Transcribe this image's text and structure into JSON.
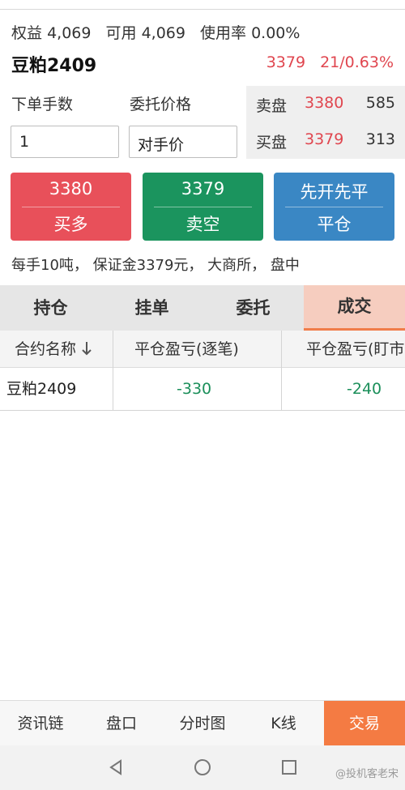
{
  "account": {
    "equity_label": "权益",
    "equity_value": "4,069",
    "available_label": "可用",
    "available_value": "4,069",
    "usage_label": "使用率",
    "usage_value": "0.00%"
  },
  "symbol": {
    "name": "豆粕2409",
    "price": "3379",
    "change": "21/0.63%"
  },
  "order_form": {
    "qty_label": "下单手数",
    "qty_value": "1",
    "price_label": "委托价格",
    "price_value": "对手价"
  },
  "order_book": [
    {
      "label": "卖盘",
      "price": "3380",
      "volume": "585"
    },
    {
      "label": "买盘",
      "price": "3379",
      "volume": "313"
    }
  ],
  "actions": {
    "buy": {
      "price": "3380",
      "label": "买多"
    },
    "sell": {
      "price": "3379",
      "label": "卖空"
    },
    "close": {
      "price": "先开先平",
      "label": "平仓"
    }
  },
  "contract_info": "每手10吨， 保证金3379元， 大商所， 盘中",
  "tabs": [
    "持仓",
    "挂单",
    "委托",
    "成交"
  ],
  "active_tab": "成交",
  "table": {
    "headers": [
      "合约名称",
      "平仓盈亏(逐笔)",
      "平仓盈亏(盯市)"
    ],
    "sort_icon": "arrow-down-icon",
    "rows": [
      {
        "contract": "豆粕2409",
        "pnl_trade": "-330",
        "pnl_mark": "-240"
      }
    ]
  },
  "bottom_nav": [
    "资讯链",
    "盘口",
    "分时图",
    "K线",
    "交易"
  ],
  "watermark": "@投机客老宋",
  "colors": {
    "red": "#e0464f",
    "green": "#1b8f5a",
    "blue": "#3a87c4",
    "orange": "#f47b43",
    "tab_active_bg": "#f6cdbf"
  }
}
